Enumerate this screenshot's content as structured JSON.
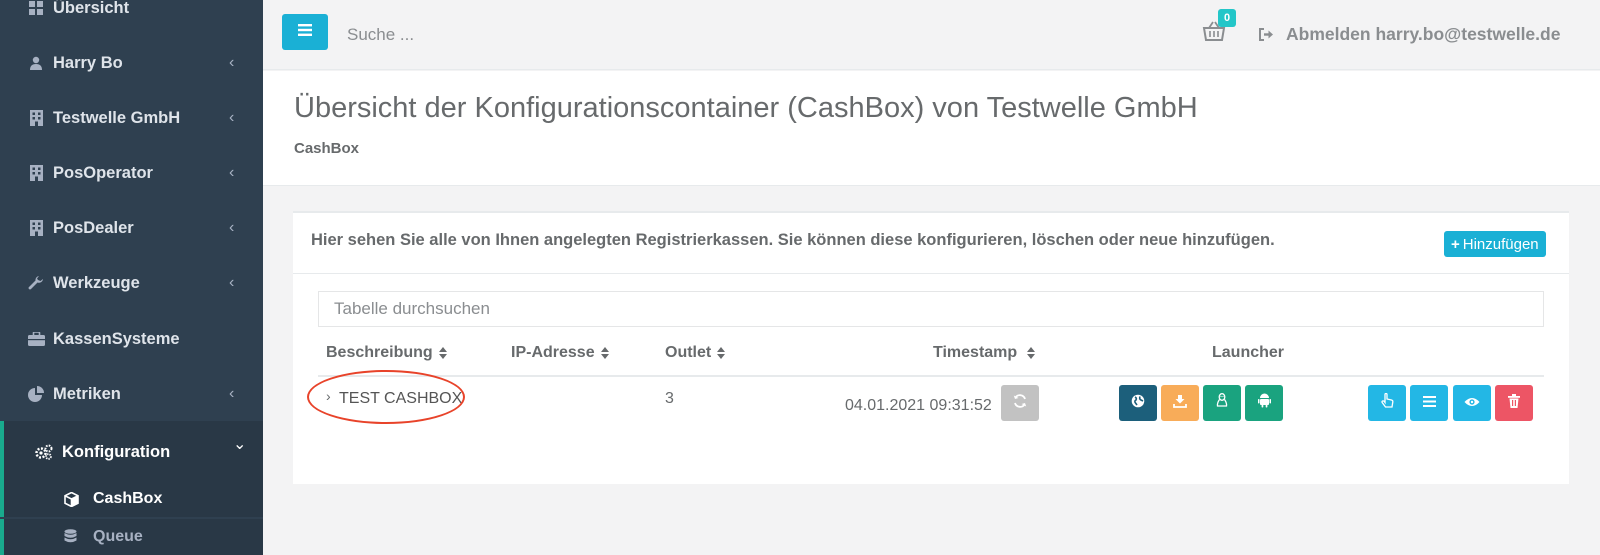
{
  "sidebar": {
    "items": [
      {
        "label": "Übersicht",
        "icon": "grid-icon"
      },
      {
        "label": "Harry Bo",
        "icon": "user-icon",
        "chevron": "‹"
      },
      {
        "label": "Testwelle GmbH",
        "icon": "building-icon",
        "chevron": "‹"
      },
      {
        "label": "PosOperator",
        "icon": "building-icon",
        "chevron": "‹"
      },
      {
        "label": "PosDealer",
        "icon": "building-icon",
        "chevron": "‹"
      },
      {
        "label": "Werkzeuge",
        "icon": "wrench-icon",
        "chevron": "‹"
      },
      {
        "label": "KassenSysteme",
        "icon": "briefcase-icon"
      },
      {
        "label": "Metriken",
        "icon": "pie-chart-icon",
        "chevron": "‹"
      },
      {
        "label": "Konfiguration",
        "icon": "cogs-icon",
        "chevron": "⌄"
      }
    ],
    "subitems": [
      {
        "label": "CashBox",
        "icon": "cube-icon"
      },
      {
        "label": "Queue",
        "icon": "database-icon"
      }
    ]
  },
  "topbar": {
    "search_placeholder": "Suche ...",
    "basket_count": "0",
    "logout_label": "Abmelden harry.bo@testwelle.de"
  },
  "heading": {
    "title": "Übersicht der Konfigurationscontainer (CashBox) von Testwelle GmbH",
    "breadcrumb": "CashBox"
  },
  "panel": {
    "description": "Hier sehen Sie alle von Ihnen angelegten Registrierkassen. Sie können diese konfigurieren, löschen oder neue hinzufügen.",
    "add_label": "Hinzufügen",
    "table_search_placeholder": "Tabelle durchsuchen"
  },
  "table": {
    "columns": [
      "Beschreibung",
      "IP-Adresse",
      "Outlet",
      "Timestamp",
      "Launcher"
    ],
    "rows": [
      {
        "beschreibung": "TEST CASHBOX",
        "ip": "",
        "outlet": "3",
        "timestamp": "04.01.2021 09:31:52"
      }
    ]
  },
  "colors": {
    "sidebar_bg": "#2f4050",
    "accent": "#1ab0d5",
    "highlight_circle": "#e8432a",
    "launcher_web": "#1c5f7b",
    "launcher_download": "#f8ac59",
    "launcher_linux": "#1aa37f",
    "launcher_android": "#1aa37f",
    "action_info": "#23b7e5",
    "action_delete": "#ed5565",
    "refresh": "#c2c2c2"
  },
  "icons": {
    "launcher": [
      "globe-icon",
      "download-icon",
      "linux-icon",
      "android-icon"
    ],
    "actions": [
      "hand-pointer-icon",
      "list-icon",
      "eye-icon",
      "trash-icon"
    ],
    "refresh": "refresh-icon"
  }
}
